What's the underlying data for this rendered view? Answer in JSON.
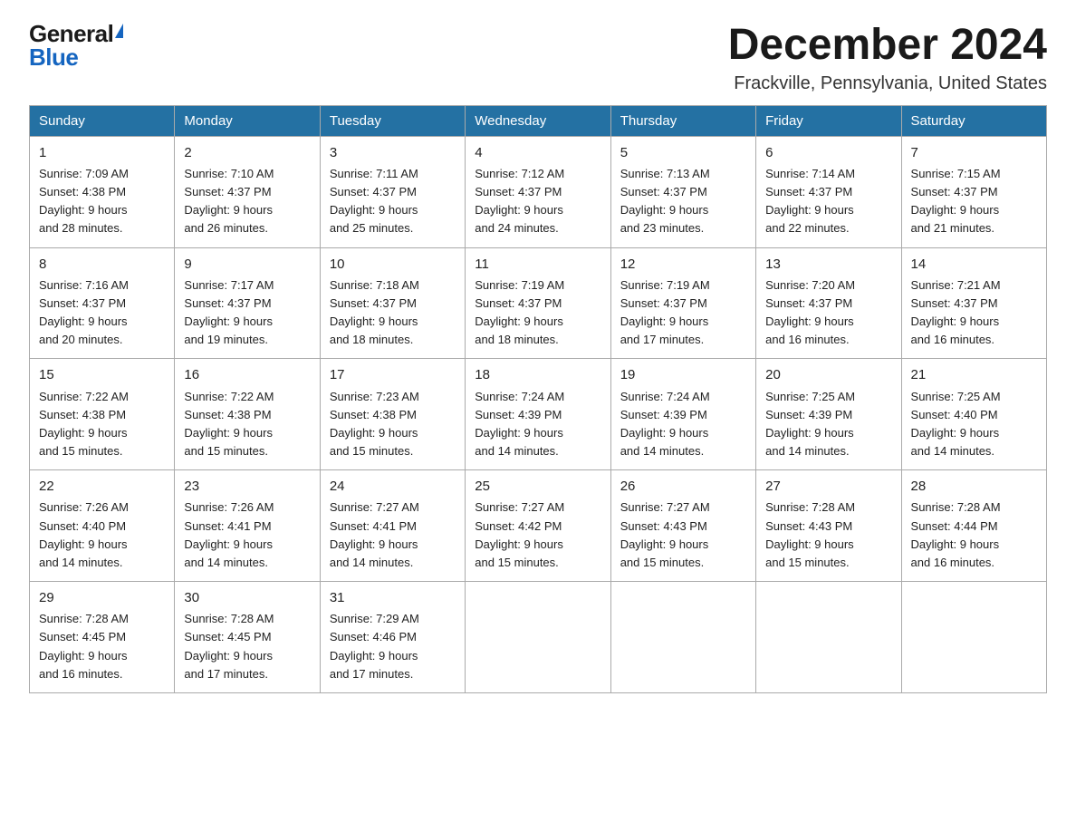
{
  "logo": {
    "general": "General",
    "blue": "Blue"
  },
  "header": {
    "month_title": "December 2024",
    "location": "Frackville, Pennsylvania, United States"
  },
  "days_of_week": [
    "Sunday",
    "Monday",
    "Tuesday",
    "Wednesday",
    "Thursday",
    "Friday",
    "Saturday"
  ],
  "weeks": [
    [
      {
        "day": "1",
        "sunrise": "7:09 AM",
        "sunset": "4:38 PM",
        "daylight": "9 hours and 28 minutes."
      },
      {
        "day": "2",
        "sunrise": "7:10 AM",
        "sunset": "4:37 PM",
        "daylight": "9 hours and 26 minutes."
      },
      {
        "day": "3",
        "sunrise": "7:11 AM",
        "sunset": "4:37 PM",
        "daylight": "9 hours and 25 minutes."
      },
      {
        "day": "4",
        "sunrise": "7:12 AM",
        "sunset": "4:37 PM",
        "daylight": "9 hours and 24 minutes."
      },
      {
        "day": "5",
        "sunrise": "7:13 AM",
        "sunset": "4:37 PM",
        "daylight": "9 hours and 23 minutes."
      },
      {
        "day": "6",
        "sunrise": "7:14 AM",
        "sunset": "4:37 PM",
        "daylight": "9 hours and 22 minutes."
      },
      {
        "day": "7",
        "sunrise": "7:15 AM",
        "sunset": "4:37 PM",
        "daylight": "9 hours and 21 minutes."
      }
    ],
    [
      {
        "day": "8",
        "sunrise": "7:16 AM",
        "sunset": "4:37 PM",
        "daylight": "9 hours and 20 minutes."
      },
      {
        "day": "9",
        "sunrise": "7:17 AM",
        "sunset": "4:37 PM",
        "daylight": "9 hours and 19 minutes."
      },
      {
        "day": "10",
        "sunrise": "7:18 AM",
        "sunset": "4:37 PM",
        "daylight": "9 hours and 18 minutes."
      },
      {
        "day": "11",
        "sunrise": "7:19 AM",
        "sunset": "4:37 PM",
        "daylight": "9 hours and 18 minutes."
      },
      {
        "day": "12",
        "sunrise": "7:19 AM",
        "sunset": "4:37 PM",
        "daylight": "9 hours and 17 minutes."
      },
      {
        "day": "13",
        "sunrise": "7:20 AM",
        "sunset": "4:37 PM",
        "daylight": "9 hours and 16 minutes."
      },
      {
        "day": "14",
        "sunrise": "7:21 AM",
        "sunset": "4:37 PM",
        "daylight": "9 hours and 16 minutes."
      }
    ],
    [
      {
        "day": "15",
        "sunrise": "7:22 AM",
        "sunset": "4:38 PM",
        "daylight": "9 hours and 15 minutes."
      },
      {
        "day": "16",
        "sunrise": "7:22 AM",
        "sunset": "4:38 PM",
        "daylight": "9 hours and 15 minutes."
      },
      {
        "day": "17",
        "sunrise": "7:23 AM",
        "sunset": "4:38 PM",
        "daylight": "9 hours and 15 minutes."
      },
      {
        "day": "18",
        "sunrise": "7:24 AM",
        "sunset": "4:39 PM",
        "daylight": "9 hours and 14 minutes."
      },
      {
        "day": "19",
        "sunrise": "7:24 AM",
        "sunset": "4:39 PM",
        "daylight": "9 hours and 14 minutes."
      },
      {
        "day": "20",
        "sunrise": "7:25 AM",
        "sunset": "4:39 PM",
        "daylight": "9 hours and 14 minutes."
      },
      {
        "day": "21",
        "sunrise": "7:25 AM",
        "sunset": "4:40 PM",
        "daylight": "9 hours and 14 minutes."
      }
    ],
    [
      {
        "day": "22",
        "sunrise": "7:26 AM",
        "sunset": "4:40 PM",
        "daylight": "9 hours and 14 minutes."
      },
      {
        "day": "23",
        "sunrise": "7:26 AM",
        "sunset": "4:41 PM",
        "daylight": "9 hours and 14 minutes."
      },
      {
        "day": "24",
        "sunrise": "7:27 AM",
        "sunset": "4:41 PM",
        "daylight": "9 hours and 14 minutes."
      },
      {
        "day": "25",
        "sunrise": "7:27 AM",
        "sunset": "4:42 PM",
        "daylight": "9 hours and 15 minutes."
      },
      {
        "day": "26",
        "sunrise": "7:27 AM",
        "sunset": "4:43 PM",
        "daylight": "9 hours and 15 minutes."
      },
      {
        "day": "27",
        "sunrise": "7:28 AM",
        "sunset": "4:43 PM",
        "daylight": "9 hours and 15 minutes."
      },
      {
        "day": "28",
        "sunrise": "7:28 AM",
        "sunset": "4:44 PM",
        "daylight": "9 hours and 16 minutes."
      }
    ],
    [
      {
        "day": "29",
        "sunrise": "7:28 AM",
        "sunset": "4:45 PM",
        "daylight": "9 hours and 16 minutes."
      },
      {
        "day": "30",
        "sunrise": "7:28 AM",
        "sunset": "4:45 PM",
        "daylight": "9 hours and 17 minutes."
      },
      {
        "day": "31",
        "sunrise": "7:29 AM",
        "sunset": "4:46 PM",
        "daylight": "9 hours and 17 minutes."
      },
      null,
      null,
      null,
      null
    ]
  ],
  "labels": {
    "sunrise": "Sunrise:",
    "sunset": "Sunset:",
    "daylight": "Daylight:"
  }
}
